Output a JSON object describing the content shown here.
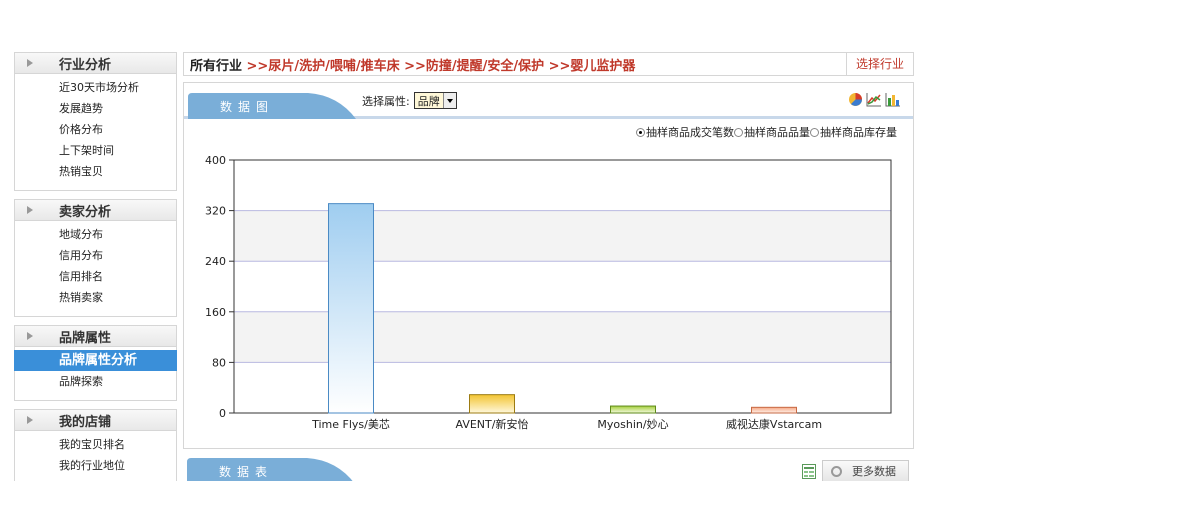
{
  "sidebar": {
    "sections": [
      {
        "title": "行业分析",
        "items": [
          {
            "label": "近30天市场分析"
          },
          {
            "label": "发展趋势"
          },
          {
            "label": "价格分布"
          },
          {
            "label": "上下架时间"
          },
          {
            "label": "热销宝贝"
          }
        ]
      },
      {
        "title": "卖家分析",
        "items": [
          {
            "label": "地域分布"
          },
          {
            "label": "信用分布"
          },
          {
            "label": "信用排名"
          },
          {
            "label": "热销卖家"
          }
        ]
      },
      {
        "title": "品牌属性",
        "items": [
          {
            "label": "品牌属性分析",
            "active": true
          },
          {
            "label": "品牌探索"
          }
        ]
      },
      {
        "title": "我的店铺",
        "items": [
          {
            "label": "我的宝贝排名"
          },
          {
            "label": "我的行业地位"
          }
        ]
      }
    ]
  },
  "breadcrumb": {
    "root": "所有行业",
    "path": " >>尿片/洗护/喂哺/推车床 >>防撞/提醒/安全/保护 >>婴儿监护器",
    "select_industry": "选择行业"
  },
  "chart_panel": {
    "tab_label": "数据图",
    "attr_label": "选择属性:",
    "attr_value": "品牌",
    "tools": [
      "pie-chart-icon",
      "line-chart-icon",
      "bar-chart-icon"
    ],
    "radios": [
      {
        "label": "抽样商品成交笔数",
        "checked": true
      },
      {
        "label": "抽样商品品量",
        "checked": false
      },
      {
        "label": "抽样商品库存量",
        "checked": false
      }
    ]
  },
  "chart_data": {
    "type": "bar",
    "categories": [
      "Time Flys/美芯",
      "AVENT/新安怡",
      "Myoshin/妙心",
      "威视达康Vstarcam"
    ],
    "values": [
      331,
      29,
      11,
      9
    ],
    "yticks": [
      0,
      80,
      160,
      240,
      320,
      400
    ],
    "ylim": [
      0,
      400
    ],
    "grid": true,
    "colors": [
      [
        "#ffffff",
        "#9fcdf0"
      ],
      [
        "#fff8dc",
        "#f2c431"
      ],
      [
        "#f4fadf",
        "#a4cf3a"
      ],
      [
        "#fff2ea",
        "#f6a784"
      ]
    ],
    "strokes": [
      "#4a8ac4",
      "#9c7b12",
      "#5e8a1a",
      "#c76a45"
    ]
  },
  "table_panel": {
    "tab_label": "数据表",
    "more_label": "更多数据",
    "export_icon": "excel-export-icon"
  }
}
